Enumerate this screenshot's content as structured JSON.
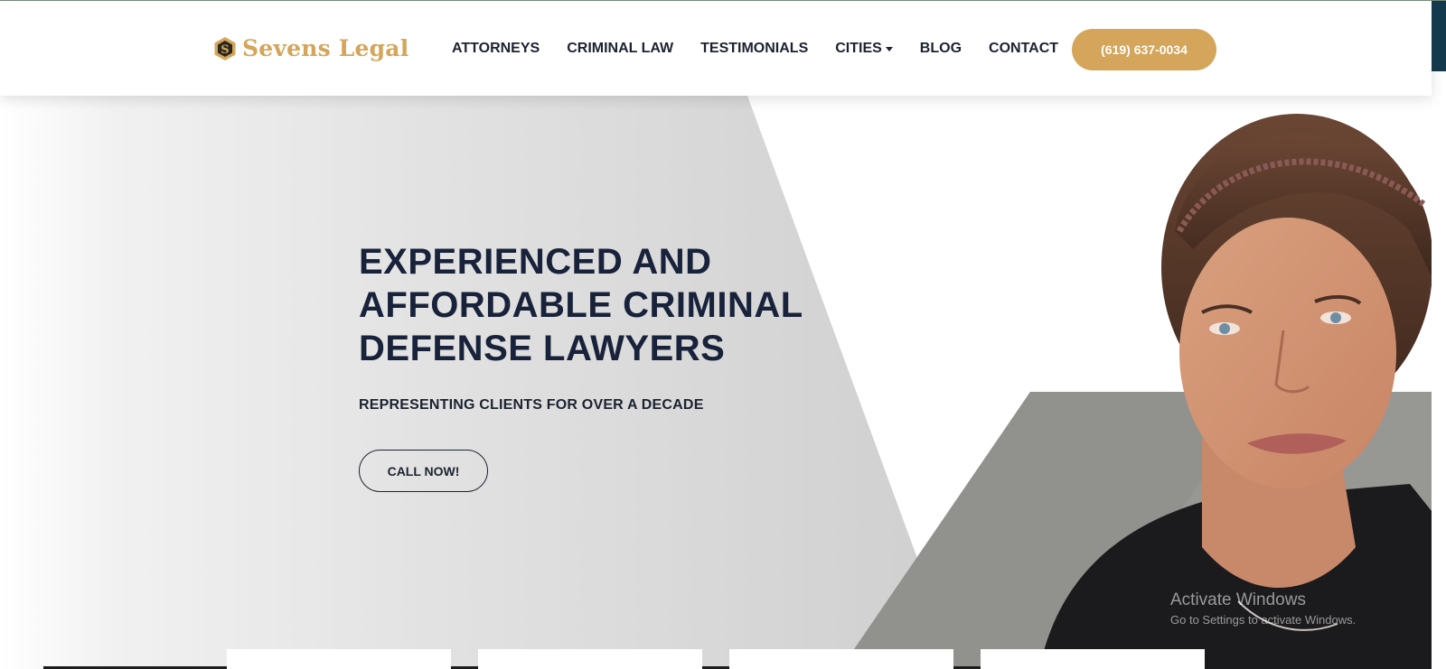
{
  "brand": {
    "name": "Sevens Legal",
    "color": "#d4a55a"
  },
  "nav": {
    "items": [
      {
        "label": "ATTORNEYS"
      },
      {
        "label": "CRIMINAL LAW"
      },
      {
        "label": "TESTIMONIALS"
      },
      {
        "label": "CITIES"
      },
      {
        "label": "BLOG"
      },
      {
        "label": "CONTACT"
      }
    ],
    "phone": "(619) 637-0034"
  },
  "hero": {
    "headline_lines": [
      "EXPERIENCED AND",
      "AFFORDABLE CRIMINAL",
      "DEFENSE LAWYERS"
    ],
    "subheadline": "REPRESENTING CLIENTS FOR OVER A DECADE",
    "cta": "CALL NOW!"
  },
  "watermark": {
    "title": "Activate Windows",
    "subtitle": "Go to Settings to activate Windows."
  },
  "colors": {
    "navy": "#18223a",
    "gold": "#d4a55a",
    "dark_teal": "#123a4c"
  }
}
